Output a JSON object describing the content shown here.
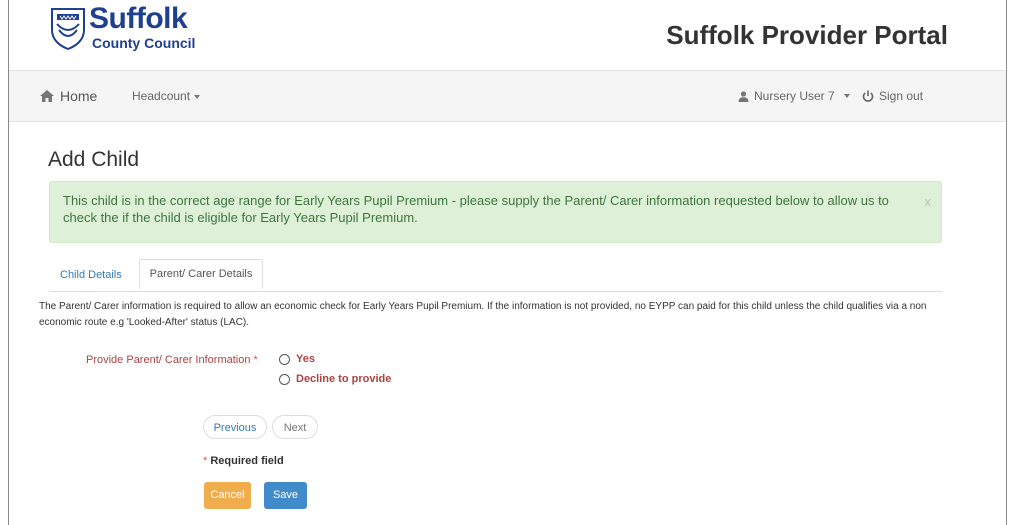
{
  "header": {
    "logo_line1": "Suffolk",
    "logo_line2": "County Council",
    "portal_title": "Suffolk Provider Portal"
  },
  "nav": {
    "home": "Home",
    "headcount": "Headcount",
    "user": "Nursery User 7",
    "sign_out": "Sign out"
  },
  "page": {
    "title": "Add Child"
  },
  "alert": {
    "text": "This child is in the correct age range for Early Years Pupil Premium - please supply the Parent/ Carer information requested below to allow us to check the if the child is eligible for Early Years Pupil Premium.",
    "close": "x"
  },
  "tabs": [
    {
      "label": "Child Details"
    },
    {
      "label": "Parent/ Carer Details"
    }
  ],
  "info_text": "The Parent/ Carer information is required to allow an economic check for Early Years Pupil Premium. If the information is not provided, no EYPP can paid for this child unless the child qualifies via a non economic route e.g 'Looked-After' status (LAC).",
  "form": {
    "field_label": "Provide Parent/ Carer Information",
    "required_marker": "*",
    "options": [
      {
        "label": "Yes"
      },
      {
        "label": "Decline to provide"
      }
    ]
  },
  "pager": {
    "previous": "Previous",
    "next": "Next"
  },
  "required_note": {
    "star": "*",
    "text": "Required field"
  },
  "buttons": {
    "cancel": "Cancel",
    "save": "Save"
  },
  "colors": {
    "alert_bg": "#dff0d8",
    "cancel": "#f0ad4e",
    "save": "#428bca",
    "label_red": "#a94442"
  }
}
